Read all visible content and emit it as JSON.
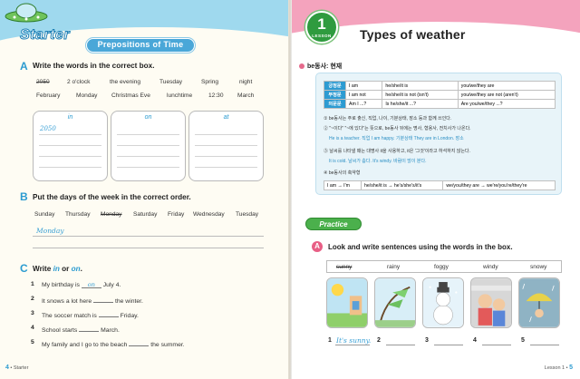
{
  "left_page": {
    "starter_label": "Starter",
    "section_title": "Prepositions of Time",
    "section_a": {
      "letter": "A",
      "instruction": "Write the words in the correct box.",
      "words": [
        "2050",
        "2 o'clock",
        "the evening",
        "Tuesday",
        "Spring",
        "night",
        "February",
        "Monday",
        "Christmas Eve",
        "lunchtime",
        "12:30",
        "March"
      ],
      "crossed_out": "2050",
      "boxes": [
        {
          "label": "in",
          "example": "2050"
        },
        {
          "label": "on",
          "example": ""
        },
        {
          "label": "at",
          "example": ""
        }
      ]
    },
    "section_b": {
      "letter": "B",
      "instruction": "Put the days of the week in the correct order.",
      "days": [
        "Sunday",
        "Thursday",
        "Monday",
        "Saturday",
        "Friday",
        "Wednesday",
        "Tuesday"
      ],
      "crossed_out": "Monday",
      "answer": "Monday"
    },
    "section_c": {
      "letter": "C",
      "instruction_prefix": "Write",
      "word_in": "in",
      "word_or": "or",
      "word_on": "on",
      "sentences": [
        {
          "num": "1",
          "before": "My birthday is",
          "answer": "on",
          "after": "July 4."
        },
        {
          "num": "2",
          "before": "It snows a lot here",
          "answer": "",
          "after": "the winter."
        },
        {
          "num": "3",
          "before": "The soccer match is",
          "answer": "",
          "after": "Friday."
        },
        {
          "num": "4",
          "before": "School starts",
          "answer": "",
          "after": "March."
        },
        {
          "num": "5",
          "before": "My family and I go to the beach",
          "answer": "",
          "after": "the summer."
        }
      ]
    },
    "folio": {
      "page": "4",
      "label": "Starter"
    }
  },
  "right_page": {
    "lesson_word": "LESSON",
    "lesson_number": "1",
    "title": "Types of weather",
    "grammar_heading": "be동사: 현재",
    "grammar_table": [
      {
        "label": "긍정문",
        "c1": "I am",
        "c2": "he/she/it is",
        "c3": "you/we/they are"
      },
      {
        "label": "부정문",
        "c1": "I am not",
        "c2": "he/she/it is not (isn't)",
        "c3": "you/we/they are not (aren't)"
      },
      {
        "label": "의문문",
        "c1": "Am I ...?",
        "c2": "Is he/she/it ...?",
        "c3": "Are you/we/they ...?"
      }
    ],
    "grammar_notes": [
      "① be동사는 주로 출신, 직업, 나이, 기분상태, 장소 등과 함께 쓰인다.",
      "② \"~이다\" \"~에 있다\"는 뜻으로, be동사 뒤에는 명사, 형용사, 전치사가 나온다.",
      "He is a teacher. 직업    I am happy. 기분상태    They are in London. 장소",
      "③ 날씨를 나타낼 때는 대명사 it을 사용하고, it은 '그것'이라고 하석하지 않는다.",
      "It is cold. 날씨가 춥다.    It's windy. 바람이 많이 분다.",
      "④ be동사의 축약형"
    ],
    "contractions": [
      "I am → I'm",
      "he/she/it is → he's/she's/it's",
      "we/you/they are → we're/you're/they're"
    ],
    "practice_label": "Practice",
    "section_a": {
      "letter": "A",
      "instruction": "Look and write sentences using the words in the box.",
      "words": [
        "sunny",
        "rainy",
        "foggy",
        "windy",
        "snowy"
      ],
      "crossed_out": "sunny",
      "answers": [
        {
          "num": "1",
          "text": "It's sunny."
        },
        {
          "num": "2",
          "text": ""
        },
        {
          "num": "3",
          "text": ""
        },
        {
          "num": "4",
          "text": ""
        },
        {
          "num": "5",
          "text": ""
        }
      ]
    },
    "folio": {
      "label": "Lesson 1",
      "page": "5"
    }
  }
}
